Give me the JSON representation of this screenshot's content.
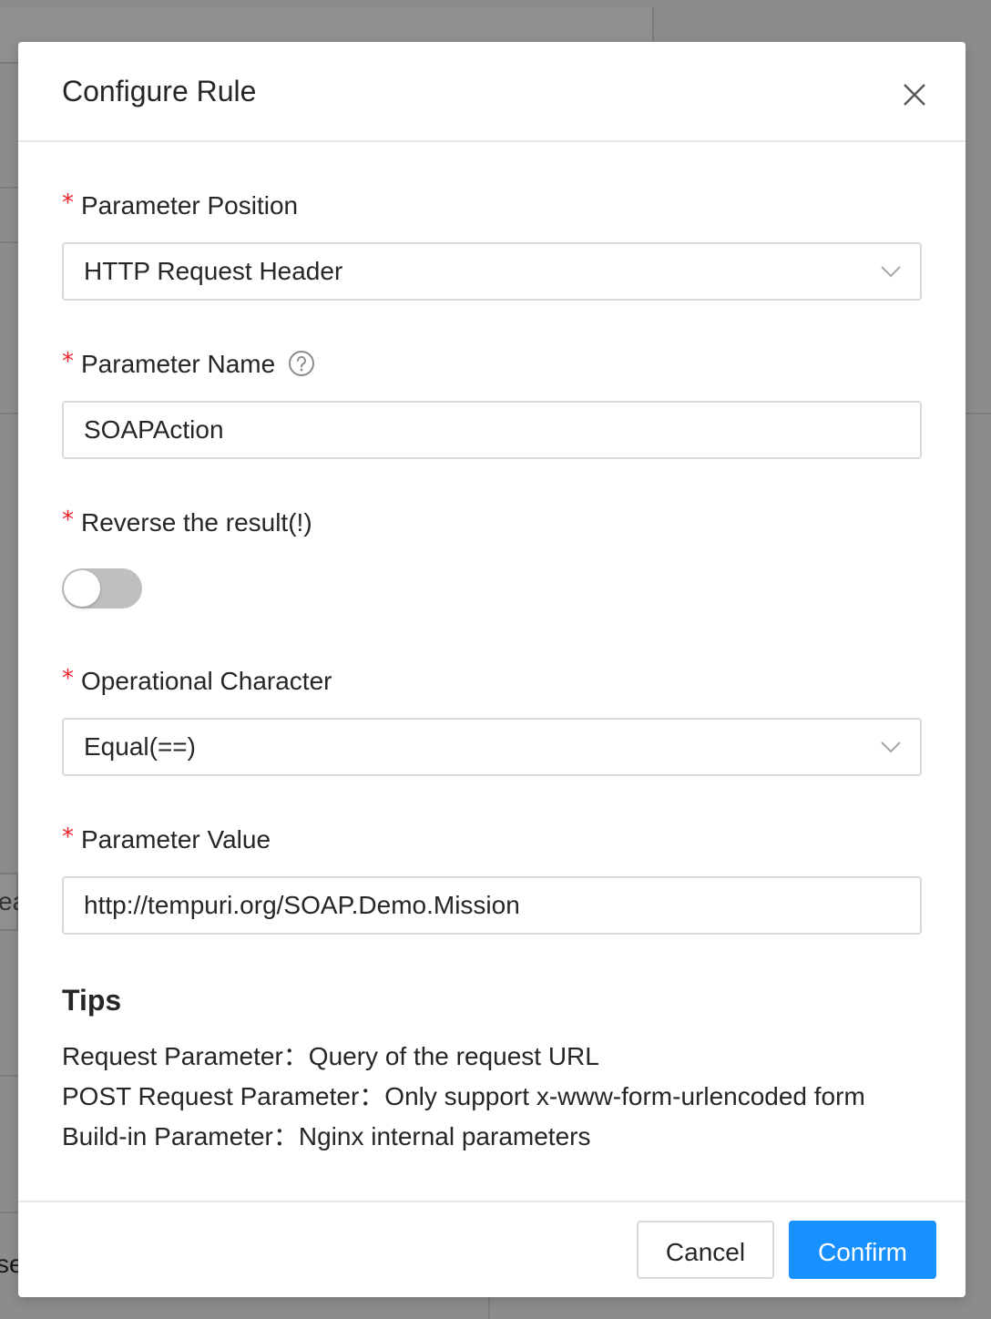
{
  "dialog": {
    "title": "Configure Rule",
    "close_icon": "close-icon"
  },
  "form": {
    "parameter_position": {
      "label": "Parameter Position",
      "value": "HTTP Request Header"
    },
    "parameter_name": {
      "label": "Parameter Name",
      "value": "SOAPAction",
      "help_icon": "question-circle-icon"
    },
    "reverse_result": {
      "label": "Reverse the result(!)",
      "enabled": false
    },
    "operational_character": {
      "label": "Operational Character",
      "value": "Equal(==)"
    },
    "parameter_value": {
      "label": "Parameter Value",
      "value": "http://tempuri.org/SOAP.Demo.Mission"
    },
    "required_mark": "*"
  },
  "tips": {
    "title": "Tips",
    "lines": [
      "Request Parameter：Query of the request URL",
      "POST Request Parameter：Only support x-www-form-urlencoded form",
      "Build-in Parameter：Nginx internal parameters"
    ]
  },
  "footer": {
    "cancel_label": "Cancel",
    "confirm_label": "Confirm"
  },
  "background": {
    "partial_text_1": "ea",
    "partial_text_2": "se"
  },
  "colors": {
    "primary": "#1890ff",
    "required": "#f5222d",
    "overlay": "#8c8c8c"
  }
}
